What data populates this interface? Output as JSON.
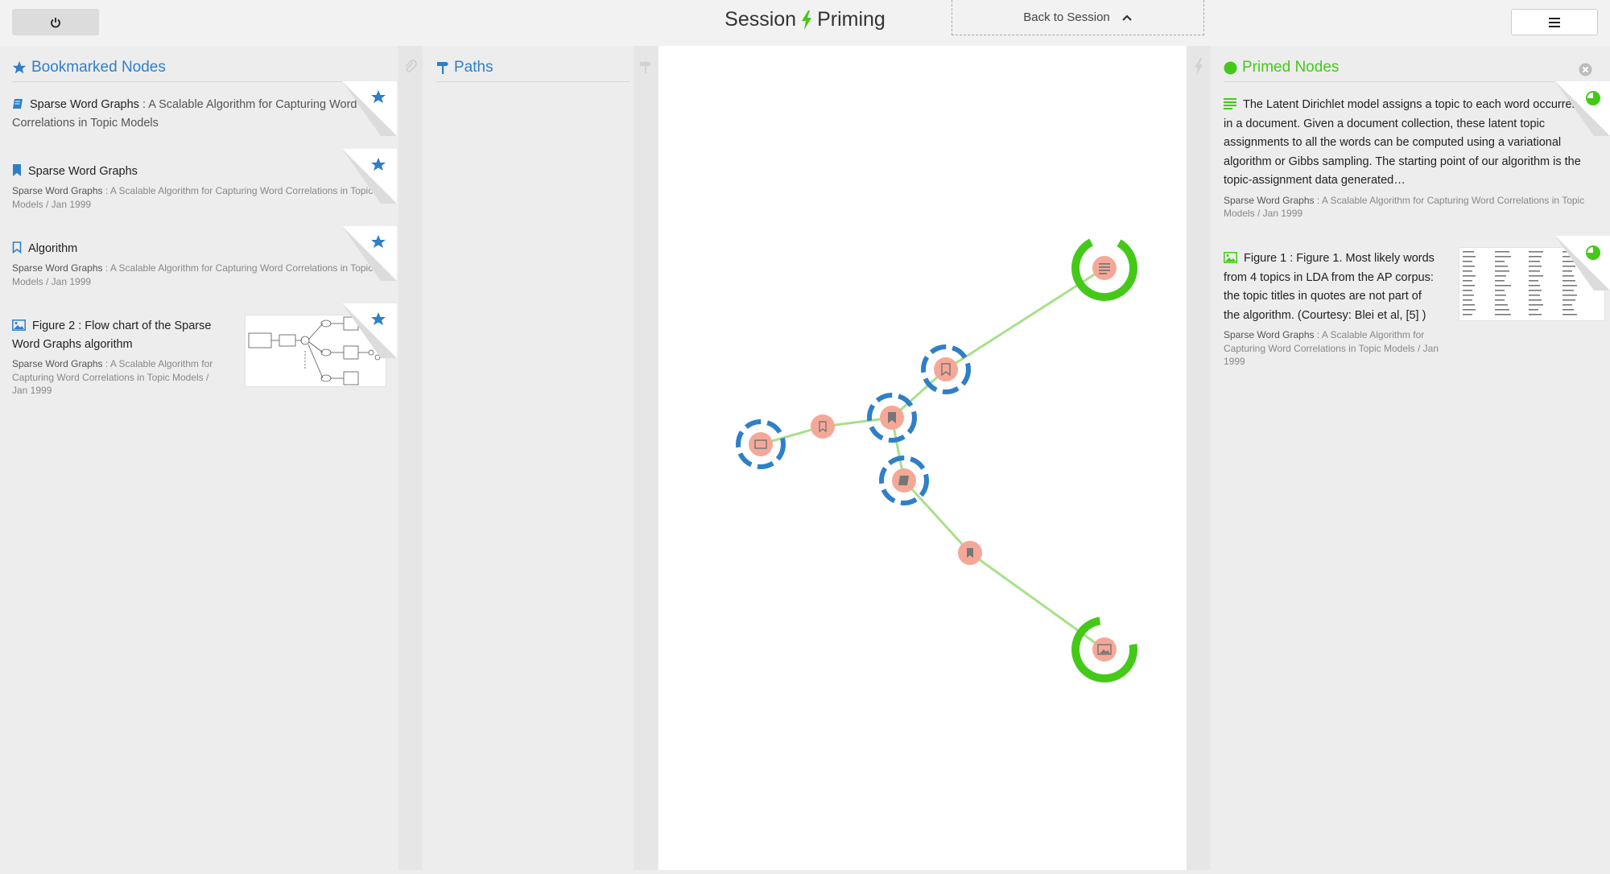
{
  "header": {
    "title_left": "Session",
    "title_right": "Priming",
    "back_label": "Back to Session"
  },
  "bookmarks": {
    "title": "Bookmarked Nodes",
    "items": [
      {
        "title": "Sparse Word Graphs",
        "subtitle": " : A Scalable Algorithm for Capturing Word Correlations in Topic Models"
      },
      {
        "title": "Sparse Word Graphs",
        "source": "Sparse Word Graphs",
        "meta": " : A Scalable Algorithm for Capturing Word Correlations in Topic Models / Jan 1999"
      },
      {
        "title": "Algorithm",
        "source": "Sparse Word Graphs",
        "meta": " : A Scalable Algorithm for Capturing Word Correlations in Topic Models / Jan 1999"
      },
      {
        "title": "Figure 2 : Flow chart of the Sparse Word Graphs algorithm",
        "source": "Sparse Word Graphs",
        "meta": " : A Scalable Algorithm for Capturing Word Correlations in Topic Models / Jan 1999"
      }
    ]
  },
  "paths": {
    "title": "Paths"
  },
  "primed": {
    "title": "Primed Nodes",
    "items": [
      {
        "text": "The Latent Dirichlet model assigns a topic to each word occurrence in a document. Given a document collection, these latent topic assignments to all the words can be computed using a variational algorithm or Gibbs sampling. The starting point of our algorithm is the topic-assignment data generated…",
        "source": "Sparse Word Graphs",
        "meta": " : A Scalable Algorithm for Capturing Word Correlations in Topic Models / Jan 1999"
      },
      {
        "text": "Figure 1 : Figure 1. Most likely words from 4 topics in LDA from the AP corpus: the topic titles in quotes are not part of the algorithm. (Courtesy: Blei et al, [5] )",
        "source": "Sparse Word Graphs",
        "meta": " : A Scalable Algorithm for Capturing Word Correlations in Topic Models / Jan 1999"
      }
    ]
  },
  "colors": {
    "accent_blue": "#2f7fc8",
    "accent_green": "#44c919",
    "node_fill": "#f5a898",
    "edge": "#a8e08a"
  }
}
